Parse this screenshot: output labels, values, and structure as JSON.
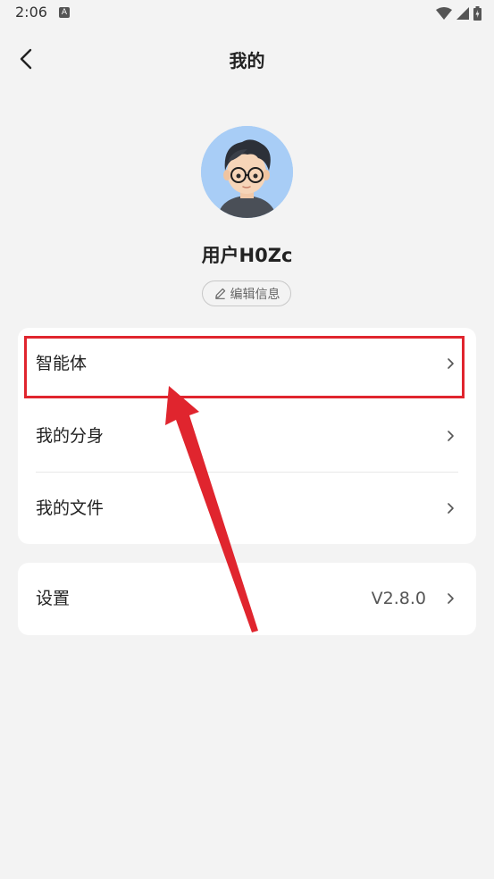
{
  "status_bar": {
    "time": "2:06",
    "notification_icon": "a-icon",
    "icons": [
      "wifi-icon",
      "signal-icon",
      "battery-icon"
    ]
  },
  "header": {
    "back_icon": "chevron-left-icon",
    "title": "我的"
  },
  "profile": {
    "username": "用户H0Zc",
    "edit_label": "编辑信息",
    "edit_icon": "pencil-icon"
  },
  "menu": {
    "items": [
      {
        "label": "智能体"
      },
      {
        "label": "我的分身"
      },
      {
        "label": "我的文件"
      }
    ]
  },
  "settings": {
    "label": "设置",
    "version": "V2.8.0"
  },
  "annotation": {
    "highlight_color": "#e0252e"
  },
  "colors": {
    "background": "#f3f3f3",
    "card": "#ffffff",
    "avatar_bg": "#a8cdf6"
  }
}
